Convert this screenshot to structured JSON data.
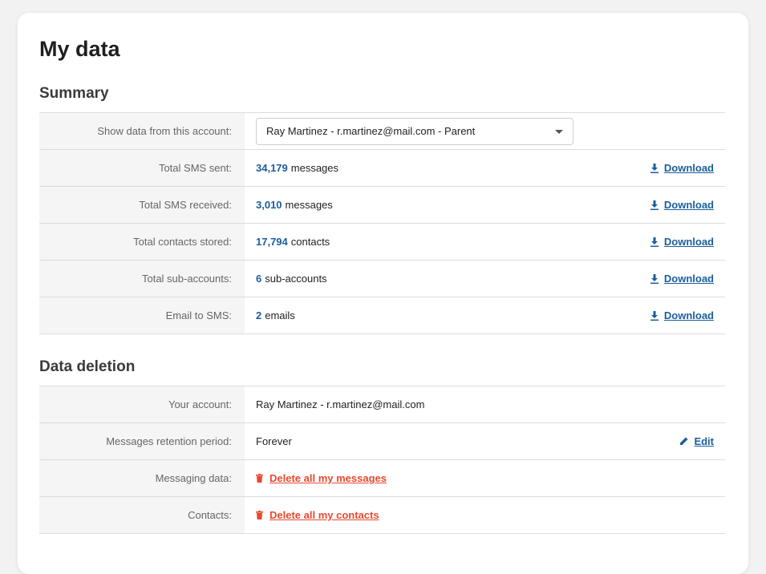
{
  "page": {
    "title": "My data"
  },
  "summary": {
    "title": "Summary",
    "account_row": {
      "label": "Show data from this account:",
      "selected": "Ray Martinez - r.martinez@mail.com - Parent"
    },
    "rows": [
      {
        "label": "Total SMS sent:",
        "value": "34,179",
        "unit": "messages",
        "action": "Download"
      },
      {
        "label": "Total SMS received:",
        "value": "3,010",
        "unit": "messages",
        "action": "Download"
      },
      {
        "label": "Total contacts stored:",
        "value": "17,794",
        "unit": "contacts",
        "action": "Download"
      },
      {
        "label": "Total sub-accounts:",
        "value": "6",
        "unit": "sub-accounts",
        "action": "Download"
      },
      {
        "label": "Email to SMS:",
        "value": "2",
        "unit": "emails",
        "action": "Download"
      }
    ]
  },
  "deletion": {
    "title": "Data deletion",
    "rows": {
      "account": {
        "label": "Your account:",
        "value": "Ray Martinez - r.martinez@mail.com"
      },
      "retention": {
        "label": "Messages retention period:",
        "value": "Forever",
        "action": "Edit"
      },
      "messaging": {
        "label": "Messaging data:",
        "action": "Delete all my messages"
      },
      "contacts": {
        "label": "Contacts:",
        "action": "Delete all my contacts"
      }
    }
  },
  "colors": {
    "link": "#1b5e9c",
    "danger": "#e8492f",
    "label_bg": "#f5f5f5"
  },
  "icons": {
    "download": "download-icon",
    "edit": "pencil-icon",
    "delete": "trash-icon"
  }
}
